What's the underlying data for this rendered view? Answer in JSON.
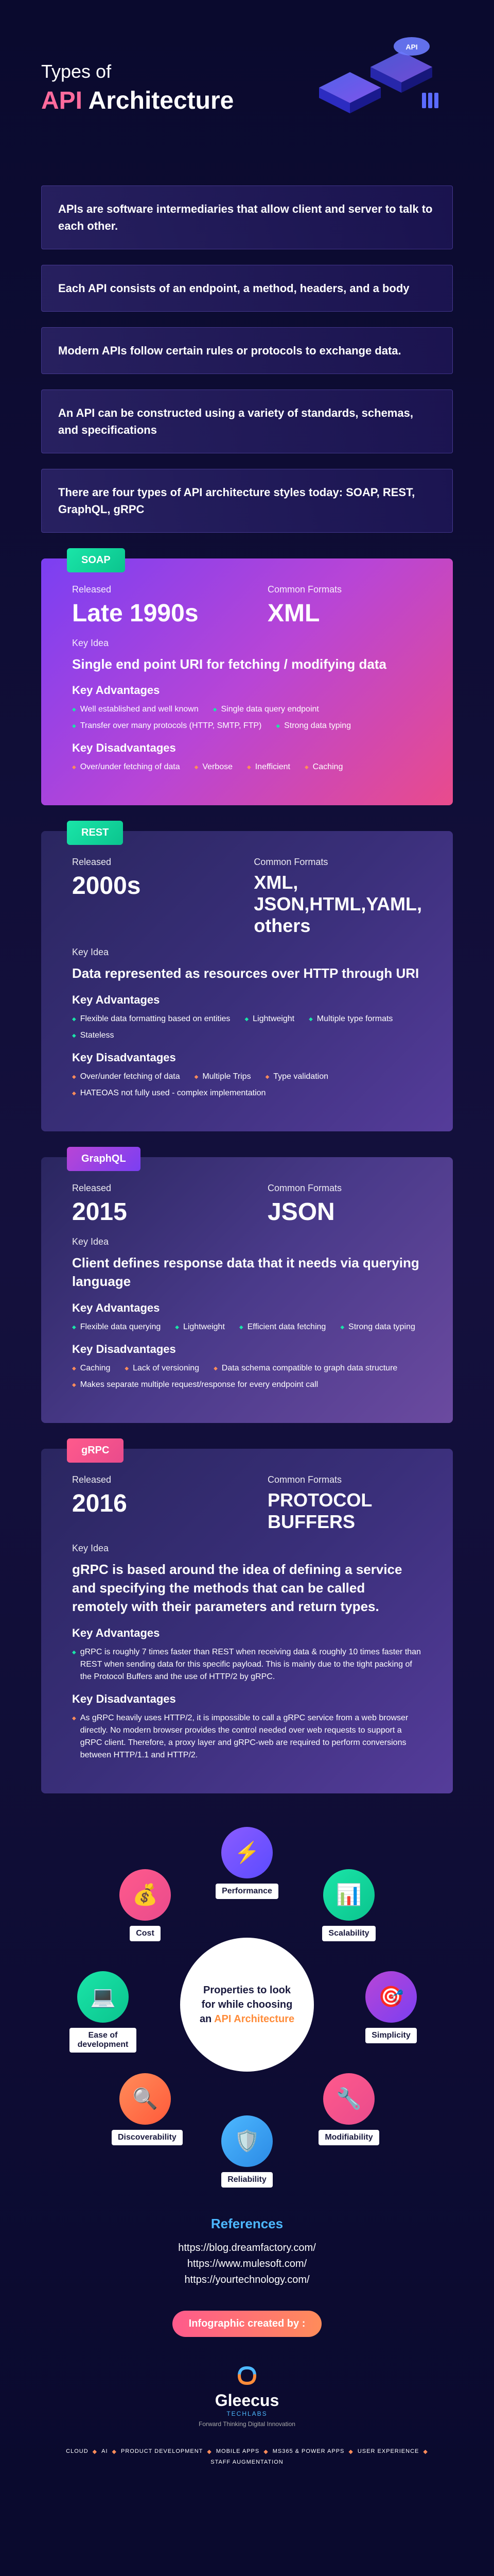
{
  "header": {
    "title_small": "Types of",
    "title_prefix": "API ",
    "title_main": "Architecture"
  },
  "intro": [
    "APIs are software intermediaries that allow client and server to talk to each other.",
    "Each API consists of an endpoint, a method, headers, and a body",
    "Modern APIs follow certain rules or protocols to exchange data.",
    "An API can be constructed using a variety of standards, schemas, and specifications",
    "There are four types of API architecture styles today: SOAP, REST, GraphQL, gRPC"
  ],
  "labels": {
    "released": "Released",
    "formats": "Common Formats",
    "key_idea": "Key Idea",
    "advantages": "Key Advantages",
    "disadvantages": "Key Disadvantages"
  },
  "soap": {
    "tag": "SOAP",
    "released": "Late 1990s",
    "formats": "XML",
    "key_idea": "Single end point URI for fetching / modifying data",
    "advantages": [
      "Well established and well known",
      "Single data query endpoint",
      "Transfer over many protocols (HTTP, SMTP, FTP)",
      "Strong data typing"
    ],
    "disadvantages": [
      "Over/under fetching of data",
      "Verbose",
      "Inefficient",
      "Caching"
    ]
  },
  "rest": {
    "tag": "REST",
    "released": "2000s",
    "formats": "XML, JSON,HTML,YAML, others",
    "key_idea": "Data represented as resources over HTTP through URI",
    "advantages": [
      "Flexible data formatting based on entities",
      "Lightweight",
      "Multiple type formats",
      "Stateless"
    ],
    "disadvantages": [
      "Over/under fetching of data",
      "Multiple Trips",
      "Type validation",
      "HATEOAS not fully used - complex implementation"
    ]
  },
  "graphql": {
    "tag": "GraphQL",
    "released": "2015",
    "formats": "JSON",
    "key_idea": "Client defines response data that it needs via querying language",
    "advantages": [
      "Flexible data querying",
      "Lightweight",
      "Efficient data fetching",
      "Strong data typing"
    ],
    "disadvantages": [
      "Caching",
      "Lack of versioning",
      "Data schema compatible to graph data structure",
      "Makes separate multiple request/response for every endpoint call"
    ]
  },
  "grpc": {
    "tag": "gRPC",
    "released": "2016",
    "formats": "PROTOCOL BUFFERS",
    "key_idea": "gRPC is based around the idea of defining a service and specifying the methods that can be called remotely with their parameters and return types.",
    "advantages": [
      "gRPC is roughly 7 times faster than REST when receiving data & roughly 10 times faster than REST when sending data for this specific payload. This is mainly due to the tight packing of the Protocol Buffers and the use of HTTP/2 by gRPC."
    ],
    "disadvantages": [
      "As gRPC heavily uses HTTP/2, it is impossible to call a gRPC service from a web browser directly. No modern browser provides the control needed over web requests to support a gRPC client. Therefore, a proxy layer and gRPC-web are required to perform conversions between HTTP/1.1 and HTTP/2."
    ]
  },
  "properties": {
    "center_prefix": "Properties to look for while choosing an ",
    "center_accent": "API Architecture",
    "nodes": [
      {
        "label": "Performance",
        "icon": "⚡",
        "color": "linear-gradient(135deg,#8b5cff,#5b4bff)"
      },
      {
        "label": "Scalability",
        "icon": "📊",
        "color": "linear-gradient(135deg,#1ae5a8,#0bc48e)"
      },
      {
        "label": "Simplicity",
        "icon": "🎯",
        "color": "linear-gradient(135deg,#b845d6,#7b3ff2)"
      },
      {
        "label": "Modifiability",
        "icon": "🔧",
        "color": "linear-gradient(135deg,#ff5a8c,#e94b8c)"
      },
      {
        "label": "Reliability",
        "icon": "🛡️",
        "color": "linear-gradient(135deg,#4db8ff,#2b8ae5)"
      },
      {
        "label": "Discoverability",
        "icon": "🔍",
        "color": "linear-gradient(135deg,#ff8c5a,#ff5a3a)"
      },
      {
        "label": "Ease of development",
        "icon": "💻",
        "color": "linear-gradient(135deg,#1ae5a8,#0bc48e)"
      },
      {
        "label": "Cost",
        "icon": "💰",
        "color": "linear-gradient(135deg,#ff5a8c,#e94b8c)"
      }
    ]
  },
  "references": {
    "title": "References",
    "links": [
      "https://blog.dreamfactory.com/",
      "https://www.mulesoft.com/",
      "https://yourtechnology.com/"
    ]
  },
  "footer": {
    "created_by": "Infographic created by :",
    "logo_name": "Gleecus",
    "logo_sub": "TECHLABS",
    "tagline": "Forward Thinking Digital Innovation",
    "tags": [
      "CLOUD",
      "AI",
      "PRODUCT DEVELOPMENT",
      "MOBILE APPS",
      "MS365 & POWER APPS",
      "USER EXPERIENCE",
      "STAFF AUGMENTATION"
    ]
  }
}
